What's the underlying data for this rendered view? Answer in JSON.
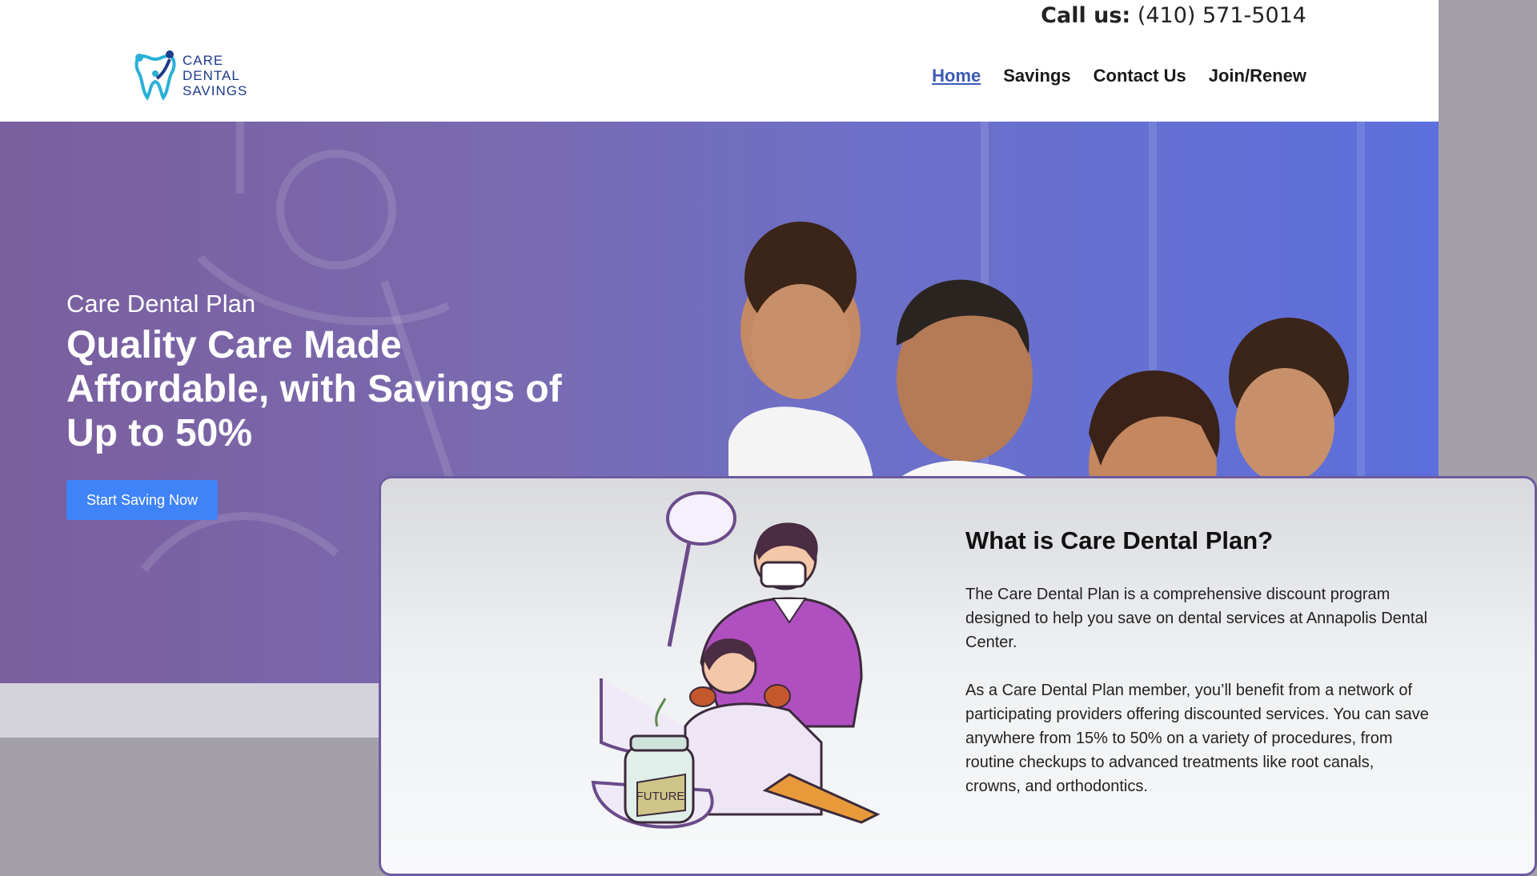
{
  "header": {
    "call_label": "Call us:",
    "phone": "(410) 571-5014",
    "logo_lines": [
      "CARE",
      "DENTAL",
      "SAVINGS"
    ],
    "nav": [
      {
        "label": "Home",
        "active": true
      },
      {
        "label": "Savings",
        "active": false
      },
      {
        "label": "Contact Us",
        "active": false
      },
      {
        "label": "Join/Renew",
        "active": false
      }
    ]
  },
  "hero": {
    "subtitle": "Care Dental Plan",
    "title": "Quality Care Made Affordable, with Savings of Up to 50%",
    "cta": "Start Saving Now"
  },
  "card": {
    "title": "What is Care Dental Plan?",
    "paragraphs": [
      "The Care Dental Plan is a comprehensive discount program designed to help you save on dental services at Annapolis Dental Center.",
      "As a Care Dental Plan member, you’ll benefit from a network of participating providers offering discounted services. You can save anywhere from 15% to 50% on a variety of procedures, from routine checkups to advanced treatments like root canals, crowns, and orthodontics."
    ],
    "jar_label": "FUTURE"
  },
  "colors": {
    "accent": "#3f83f8",
    "nav_active": "#3b5bb5",
    "card_border": "#6e5aa0"
  }
}
